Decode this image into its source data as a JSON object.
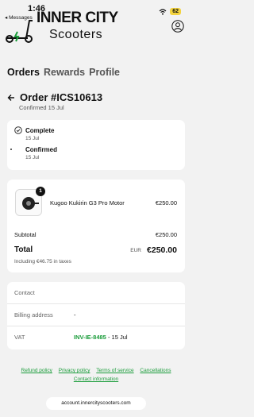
{
  "status_bar": {
    "time": "1:46",
    "back_label": "◂ Messages",
    "battery": "62"
  },
  "header": {
    "brand_line1": "INNER CITY",
    "brand_line2": "Scooters"
  },
  "tabs": [
    {
      "label": "Orders",
      "active": true
    },
    {
      "label": "Rewards",
      "active": false
    },
    {
      "label": "Profile",
      "active": false
    }
  ],
  "order": {
    "title": "Order #ICS10613",
    "confirmed": "Confirmed 15 Jul"
  },
  "timeline": [
    {
      "title": "Complete",
      "date": "15 Jul"
    },
    {
      "title": "Confirmed",
      "date": "15 Jul"
    }
  ],
  "items": [
    {
      "quantity": "1",
      "name": "Kugoo Kukirin G3 Pro Motor",
      "price": "€250.00"
    }
  ],
  "summary": {
    "subtotal_label": "Subtotal",
    "subtotal_value": "€250.00",
    "total_label": "Total",
    "currency": "EUR",
    "total_value": "€250.00",
    "taxes_note": "Including €46.75 in taxes"
  },
  "info": {
    "contact_label": "Contact",
    "billing_label": "Billing address",
    "billing_value": "-",
    "vat_label": "VAT",
    "vat_link": "INV-IE-8485",
    "vat_date": " - 15 Jul"
  },
  "footer": {
    "links": [
      "Refund policy",
      "Privacy policy",
      "Terms of service",
      "Cancellations",
      "Contact information"
    ],
    "url": "account.innercityscooters.com"
  },
  "colors": {
    "accent": "#1a9c3a",
    "background": "#f2f2f2",
    "battery": "#f3d33e"
  }
}
